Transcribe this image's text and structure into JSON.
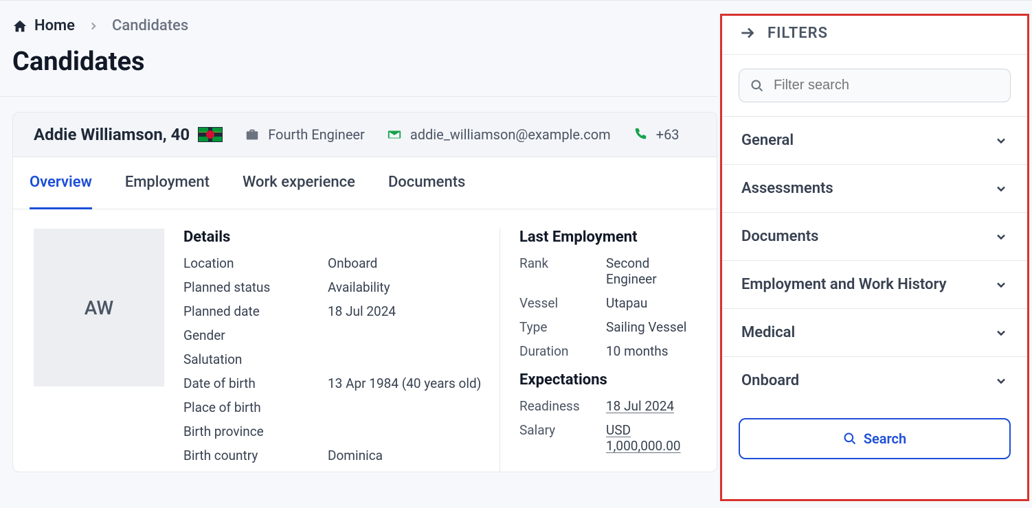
{
  "breadcrumb": {
    "home_label": "Home",
    "current": "Candidates"
  },
  "page_title": "Candidates",
  "candidate": {
    "name_age": "Addie Williamson, 40",
    "role": "Fourth Engineer",
    "email": "addie_williamson@example.com",
    "phone": "+63",
    "avatar_initials": "AW"
  },
  "tabs": {
    "overview": "Overview",
    "employment": "Employment",
    "work_experience": "Work experience",
    "documents": "Documents"
  },
  "details": {
    "heading": "Details",
    "location_k": "Location",
    "location_v": "Onboard",
    "planned_status_k": "Planned status",
    "planned_status_v": "Availability",
    "planned_date_k": "Planned date",
    "planned_date_v": "18 Jul 2024",
    "gender_k": "Gender",
    "gender_v": "",
    "salutation_k": "Salutation",
    "salutation_v": "",
    "dob_k": "Date of birth",
    "dob_v": "13 Apr 1984 (40 years old)",
    "pob_k": "Place of birth",
    "pob_v": "",
    "province_k": "Birth province",
    "province_v": "",
    "country_k": "Birth country",
    "country_v": "Dominica"
  },
  "last_employment": {
    "heading": "Last Employment",
    "rank_k": "Rank",
    "rank_v": "Second Engineer",
    "vessel_k": "Vessel",
    "vessel_v": "Utapau",
    "type_k": "Type",
    "type_v": "Sailing Vessel",
    "duration_k": "Duration",
    "duration_v": "10 months"
  },
  "expectations": {
    "heading": "Expectations",
    "readiness_k": "Readiness",
    "readiness_v": "18 Jul 2024",
    "salary_k": "Salary",
    "salary_v": "USD 1,000,000.00"
  },
  "filters": {
    "title": "FILTERS",
    "search_placeholder": "Filter search",
    "groups": {
      "general": "General",
      "assessments": "Assessments",
      "documents": "Documents",
      "employment": "Employment and Work History",
      "medical": "Medical",
      "onboard": "Onboard"
    },
    "search_button": "Search"
  }
}
